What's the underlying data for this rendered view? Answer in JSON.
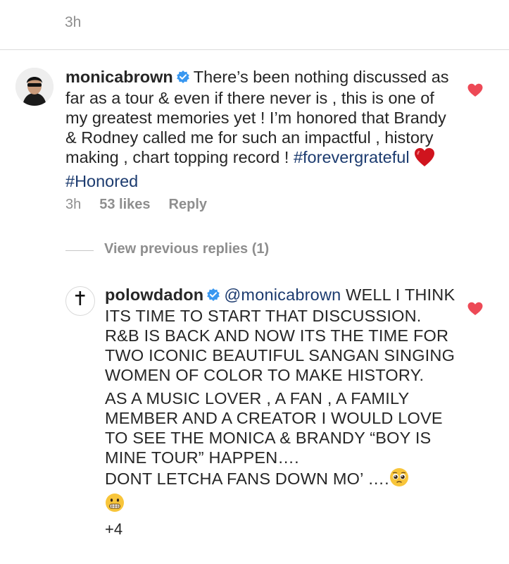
{
  "top": {
    "time": "3h"
  },
  "comment": {
    "username": "monicabrown",
    "text_part1": "There’s been nothing discussed as far as a tour & even if there never is , this is one of my greatest memories yet ! I’m honored that Brandy & Rodney called me for such an impactful , history making , chart topping record !",
    "hashtag1": "#forevergrateful",
    "hashtag2": "#Honored",
    "time": "3h",
    "likes": "53 likes",
    "reply_label": "Reply"
  },
  "view_previous": "View previous replies (1)",
  "reply": {
    "username": "polowdadon",
    "mention": "@monicabrown",
    "text_part1": "WELL I THINK ITS TIME TO START THAT DISCUSSION. R&B IS BACK AND NOW ITS THE TIME FOR TWO ICONIC BEAUTIFUL SANGAN SINGING WOMEN OF COLOR TO MAKE HISTORY.",
    "text_part2": "AS A MUSIC LOVER , A FAN , A FAMILY MEMBER AND A CREATOR I WOULD LOVE TO SEE THE MONICA & BRANDY “BOY IS MINE TOUR” HAPPEN….",
    "text_part3": "DONT LETCHA FANS DOWN MO’ ….",
    "more": "+4"
  },
  "colors": {
    "heart": "#ed4956",
    "verified": "#3897f0",
    "link": "#1c3b6f",
    "muted": "#8e8e8e"
  },
  "icons": {
    "heart_like": "heart-icon",
    "verified": "verified-badge-icon",
    "red_heart_emoji": "red-heart-emoji",
    "pleading_emoji": "pleading-face-emoji",
    "grimace_emoji": "grimacing-face-emoji"
  }
}
